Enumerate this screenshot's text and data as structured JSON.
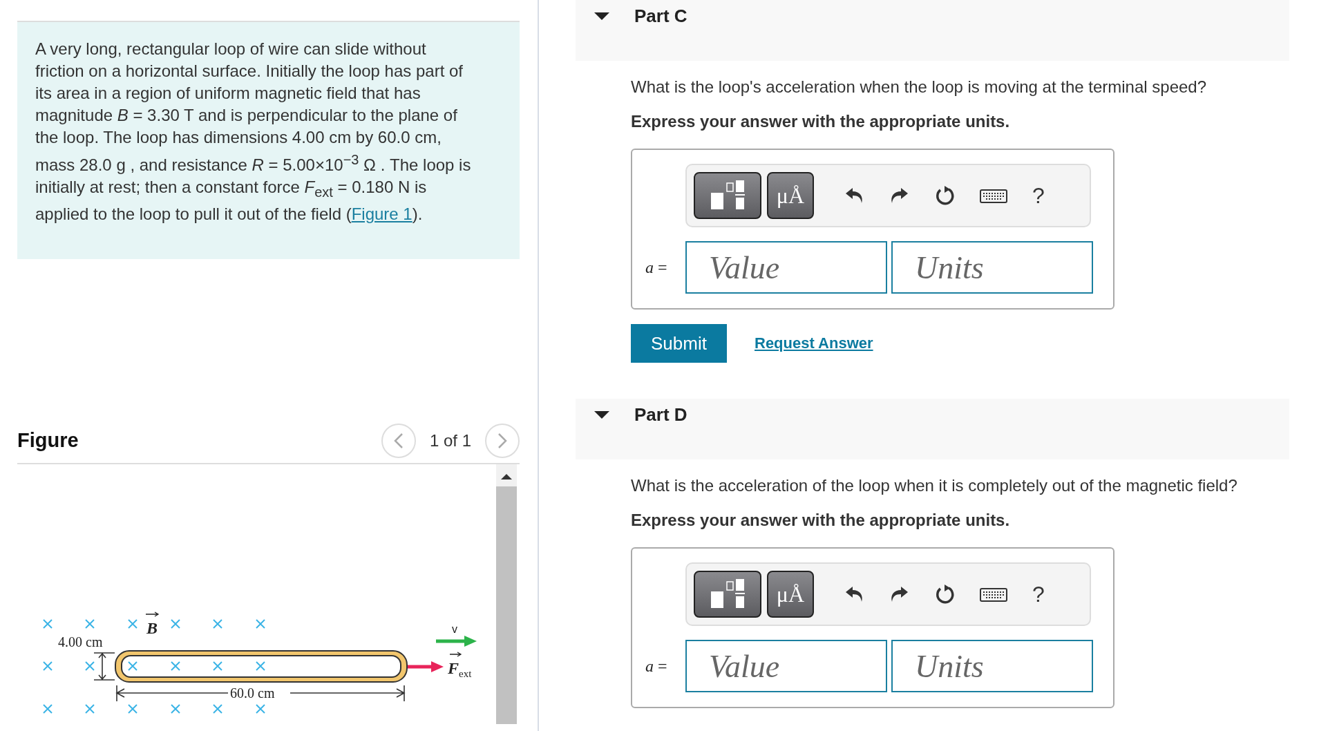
{
  "problem": {
    "text": "A very long, rectangular loop of wire can slide without friction on a horizontal surface. Initially the loop has part of its area in a region of uniform magnetic field that has magnitude *B* = 3.30  T and is perpendicular to the plane of the loop. The loop has dimensions 4.00 cm by 60.0 cm, mass 28.0  g , and resistance *R* = 5.00×10$^{−3}$  Ω . The loop is initially at rest; then a constant force *F*$_{ext}$ = 0.180 N is applied to the loop to pull it out of the field (",
    "link": "Figure 1",
    "text_after": ")."
  },
  "figure": {
    "heading": "Figure",
    "pager": "1 of 1",
    "labels": {
      "height": "4.00 cm",
      "length": "60.0 cm",
      "field": "B",
      "velocity": "v",
      "force": "F",
      "force_sub": "ext"
    }
  },
  "parts": [
    {
      "label": "Part C",
      "expanded": true,
      "question": "What is the loop's acceleration when the loop is moving at the terminal speed?",
      "instruction": "Express your answer with the appropriate units.",
      "units_button": "μÅ",
      "help": "?",
      "variable": "a",
      "equals": "=",
      "value_placeholder": "Value",
      "units_placeholder": "Units",
      "submit": "Submit",
      "request": "Request Answer"
    },
    {
      "label": "Part D",
      "expanded": true,
      "question": "What is the acceleration of the loop when it is completely out of the magnetic field?",
      "instruction": "Express your answer with the appropriate units.",
      "units_button": "μÅ",
      "help": "?",
      "variable": "a",
      "equals": "=",
      "value_placeholder": "Value",
      "units_placeholder": "Units"
    }
  ]
}
